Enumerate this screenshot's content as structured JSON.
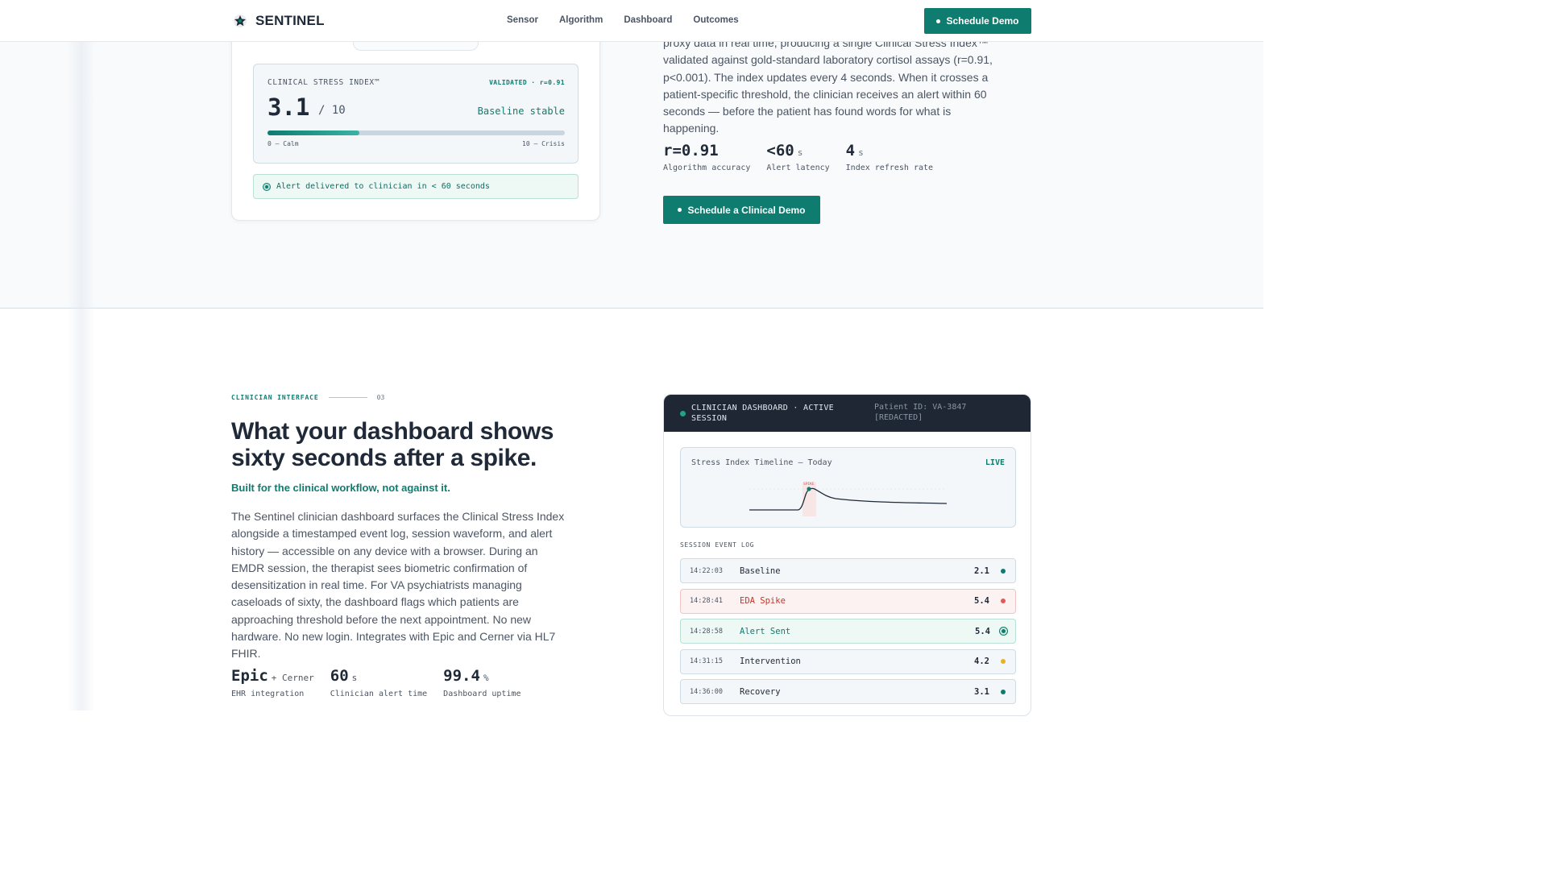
{
  "nav": {
    "brand": "SENTINEL",
    "links": [
      "Sensor",
      "Algorithm",
      "Dashboard",
      "Outcomes"
    ],
    "cta": "Schedule Demo"
  },
  "device_card": {
    "index_label": "CLINICAL STRESS INDEX™",
    "validated": "VALIDATED · r=0.91",
    "value": "3.1",
    "scale": "/ 10",
    "status": "Baseline stable",
    "progress_fraction": 0.31,
    "min_label": "0 — Calm",
    "max_label": "10 — Crisis",
    "alert": "Alert delivered to clinician in < 60 seconds"
  },
  "intro": {
    "paragraph": "proxy data in real time, producing a single Clinical Stress Index™ validated against gold-standard laboratory cortisol assays (r=0.91, p<0.001). The index updates every 4 seconds. When it crosses a patient-specific threshold, the clinician receives an alert within 60 seconds — before the patient has found words for what is happening.",
    "stats": [
      {
        "value": "r=0.91",
        "unit": "",
        "label": "Algorithm accuracy"
      },
      {
        "value": "<60",
        "unit": "s",
        "label": "Alert latency"
      },
      {
        "value": "4",
        "unit": "s",
        "label": "Index refresh rate"
      }
    ],
    "cta": "Schedule a Clinical Demo"
  },
  "section3": {
    "eyebrow": "CLINICIAN INTERFACE",
    "number": "03",
    "heading": "What your dashboard shows sixty seconds after a spike.",
    "subheading": "Built for the clinical workflow, not against it.",
    "paragraph": "The Sentinel clinician dashboard surfaces the Clinical Stress Index alongside a timestamped event log, session waveform, and alert history — accessible on any device with a browser. During an EMDR session, the therapist sees biometric confirmation of desensitization in real time. For VA psychiatrists managing caseloads of sixty, the dashboard flags which patients are approaching threshold before the next appointment. No new hardware. No new login. Integrates with Epic and Cerner via HL7 FHIR.",
    "stats": [
      {
        "value": "Epic",
        "unit": "+ Cerner",
        "label": "EHR integration"
      },
      {
        "value": "60",
        "unit": "s",
        "label": "Clinician alert time"
      },
      {
        "value": "99.4",
        "unit": "%",
        "label": "Dashboard uptime"
      }
    ]
  },
  "dashboard": {
    "title": "CLINICIAN DASHBOARD · ACTIVE SESSION",
    "patient_id": "Patient ID: VA-3847 [REDACTED]",
    "timeline_title": "Stress Index Timeline — Today",
    "live": "LIVE",
    "spike_marker": "SPIKE",
    "log_label": "SESSION EVENT LOG",
    "events": [
      {
        "time": "14:22:03",
        "event": "Baseline",
        "value": "2.1",
        "type": "normal",
        "dot_color": "#0f7c70"
      },
      {
        "time": "14:28:41",
        "event": "EDA Spike",
        "value": "5.4",
        "type": "spike",
        "dot_color": "#e05a5a"
      },
      {
        "time": "14:28:58",
        "event": "Alert Sent",
        "value": "5.4",
        "type": "alert",
        "dot_color": "#0f7c70"
      },
      {
        "time": "14:31:15",
        "event": "Intervention",
        "value": "4.2",
        "type": "normal",
        "dot_color": "#e6b422"
      },
      {
        "time": "14:36:00",
        "event": "Recovery",
        "value": "3.1",
        "type": "normal",
        "dot_color": "#0f7c70"
      }
    ]
  },
  "colors": {
    "accent": "#0f7c70",
    "dark_header": "#1e2733",
    "spike": "#c0392b"
  }
}
